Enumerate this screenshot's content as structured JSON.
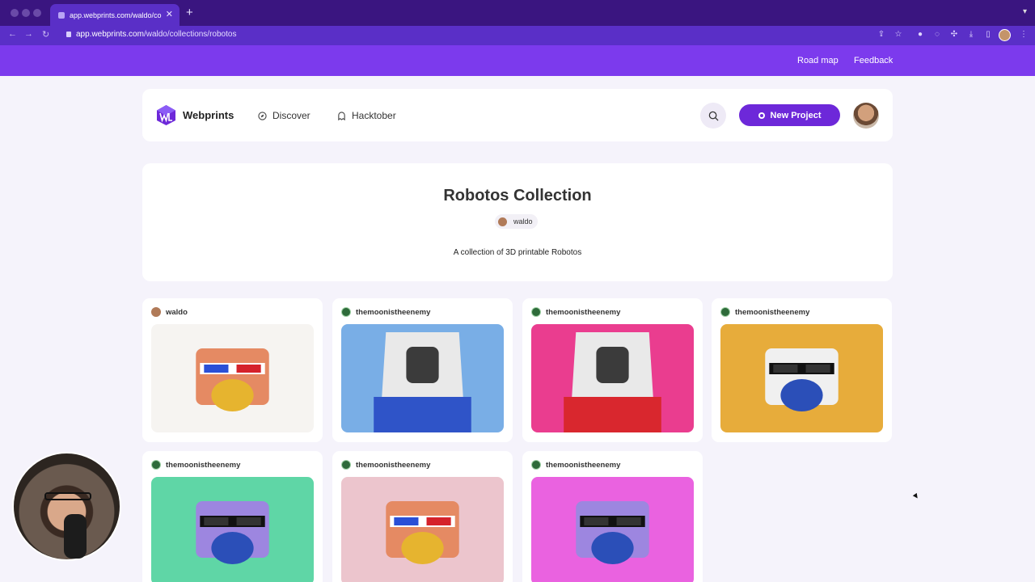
{
  "browser": {
    "tab_title": "app.webprints.com/waldo/co",
    "url_host": "app.webprints.com",
    "url_path": "/waldo/collections/robotos"
  },
  "topbar": {
    "roadmap": "Road map",
    "feedback": "Feedback"
  },
  "header": {
    "brand": "Webprints",
    "nav": [
      {
        "label": "Discover"
      },
      {
        "label": "Hacktober"
      }
    ],
    "new_project": "New Project"
  },
  "collection": {
    "title": "Robotos Collection",
    "author": "waldo",
    "description": "A collection of 3D printable Robotos"
  },
  "cards": [
    {
      "user": "waldo",
      "bg": "#f6f4f1"
    },
    {
      "user": "themoonistheenemy",
      "bg": "#79aee6"
    },
    {
      "user": "themoonistheenemy",
      "bg": "#ea3d8f"
    },
    {
      "user": "themoonistheenemy",
      "bg": "#e7ac3b"
    },
    {
      "user": "themoonistheenemy",
      "bg": "#5fd6a6"
    },
    {
      "user": "themoonistheenemy",
      "bg": "#ecc5cd"
    },
    {
      "user": "themoonistheenemy",
      "bg": "#ea62e0"
    }
  ],
  "colors": {
    "brand": "#7c3aed",
    "button": "#6d28d9"
  }
}
